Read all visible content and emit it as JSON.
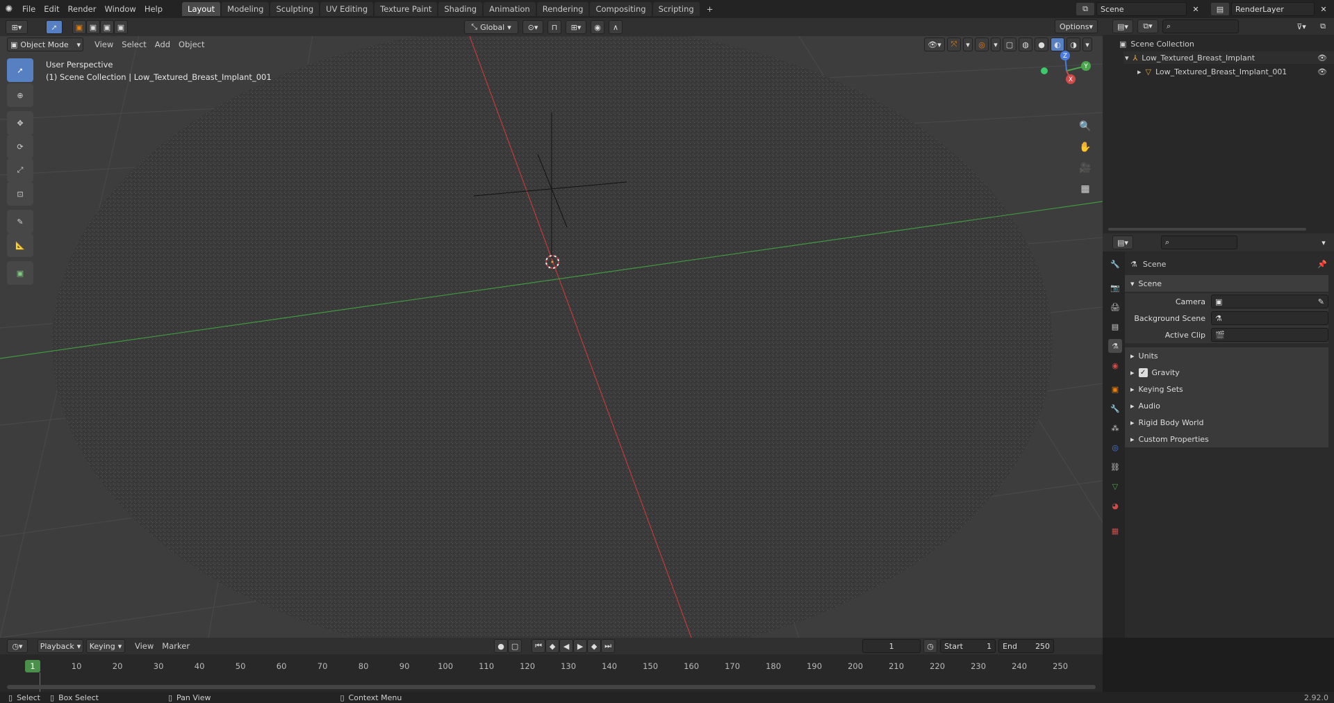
{
  "topbar": {
    "menus": [
      "File",
      "Edit",
      "Render",
      "Window",
      "Help"
    ],
    "workspaces": [
      "Layout",
      "Modeling",
      "Sculpting",
      "UV Editing",
      "Texture Paint",
      "Shading",
      "Animation",
      "Rendering",
      "Compositing",
      "Scripting"
    ],
    "active_workspace": "Layout",
    "add_tab": "+",
    "scene_name": "Scene",
    "view_layer": "RenderLayer"
  },
  "viewport_header": {
    "mode": "Object Mode",
    "menus": [
      "View",
      "Select",
      "Add",
      "Object"
    ],
    "transform_orientation": "Global",
    "options_label": "Options"
  },
  "viewport": {
    "view_name": "User Perspective",
    "collection_info": "(1) Scene Collection | Low_Textured_Breast_Implant_001",
    "gizmo": {
      "x": "X",
      "y": "Y",
      "z": "Z"
    }
  },
  "outliner": {
    "root": "Scene Collection",
    "items": [
      {
        "label": "Low_Textured_Breast_Implant"
      },
      {
        "label": "Low_Textured_Breast_Implant_001"
      }
    ]
  },
  "properties": {
    "context": "Scene",
    "panel_title": "Scene",
    "fields": [
      {
        "label": "Camera",
        "value": ""
      },
      {
        "label": "Background Scene",
        "value": ""
      },
      {
        "label": "Active Clip",
        "value": ""
      }
    ],
    "subpanels": [
      "Units",
      "Gravity",
      "Keying Sets",
      "Audio",
      "Rigid Body World",
      "Custom Properties"
    ],
    "gravity_checked": true
  },
  "timeline": {
    "menus": [
      "Playback",
      "Keying",
      "View",
      "Marker"
    ],
    "current_frame": "1",
    "start_label": "Start",
    "start": "1",
    "end_label": "End",
    "end": "250",
    "ticks": [
      "10",
      "20",
      "30",
      "40",
      "50",
      "60",
      "70",
      "80",
      "90",
      "100",
      "110",
      "120",
      "130",
      "140",
      "150",
      "160",
      "170",
      "180",
      "190",
      "200",
      "210",
      "220",
      "230",
      "240",
      "250"
    ],
    "playhead": "1"
  },
  "statusbar": {
    "select": "Select",
    "box_select": "Box Select",
    "pan_view": "Pan View",
    "context_menu": "Context Menu",
    "version": "2.92.0"
  },
  "colors": {
    "accent": "#5680c2",
    "x_axis": "#c23a3a",
    "y_axis": "#3f9a3f",
    "orange": "#e87d0d"
  }
}
